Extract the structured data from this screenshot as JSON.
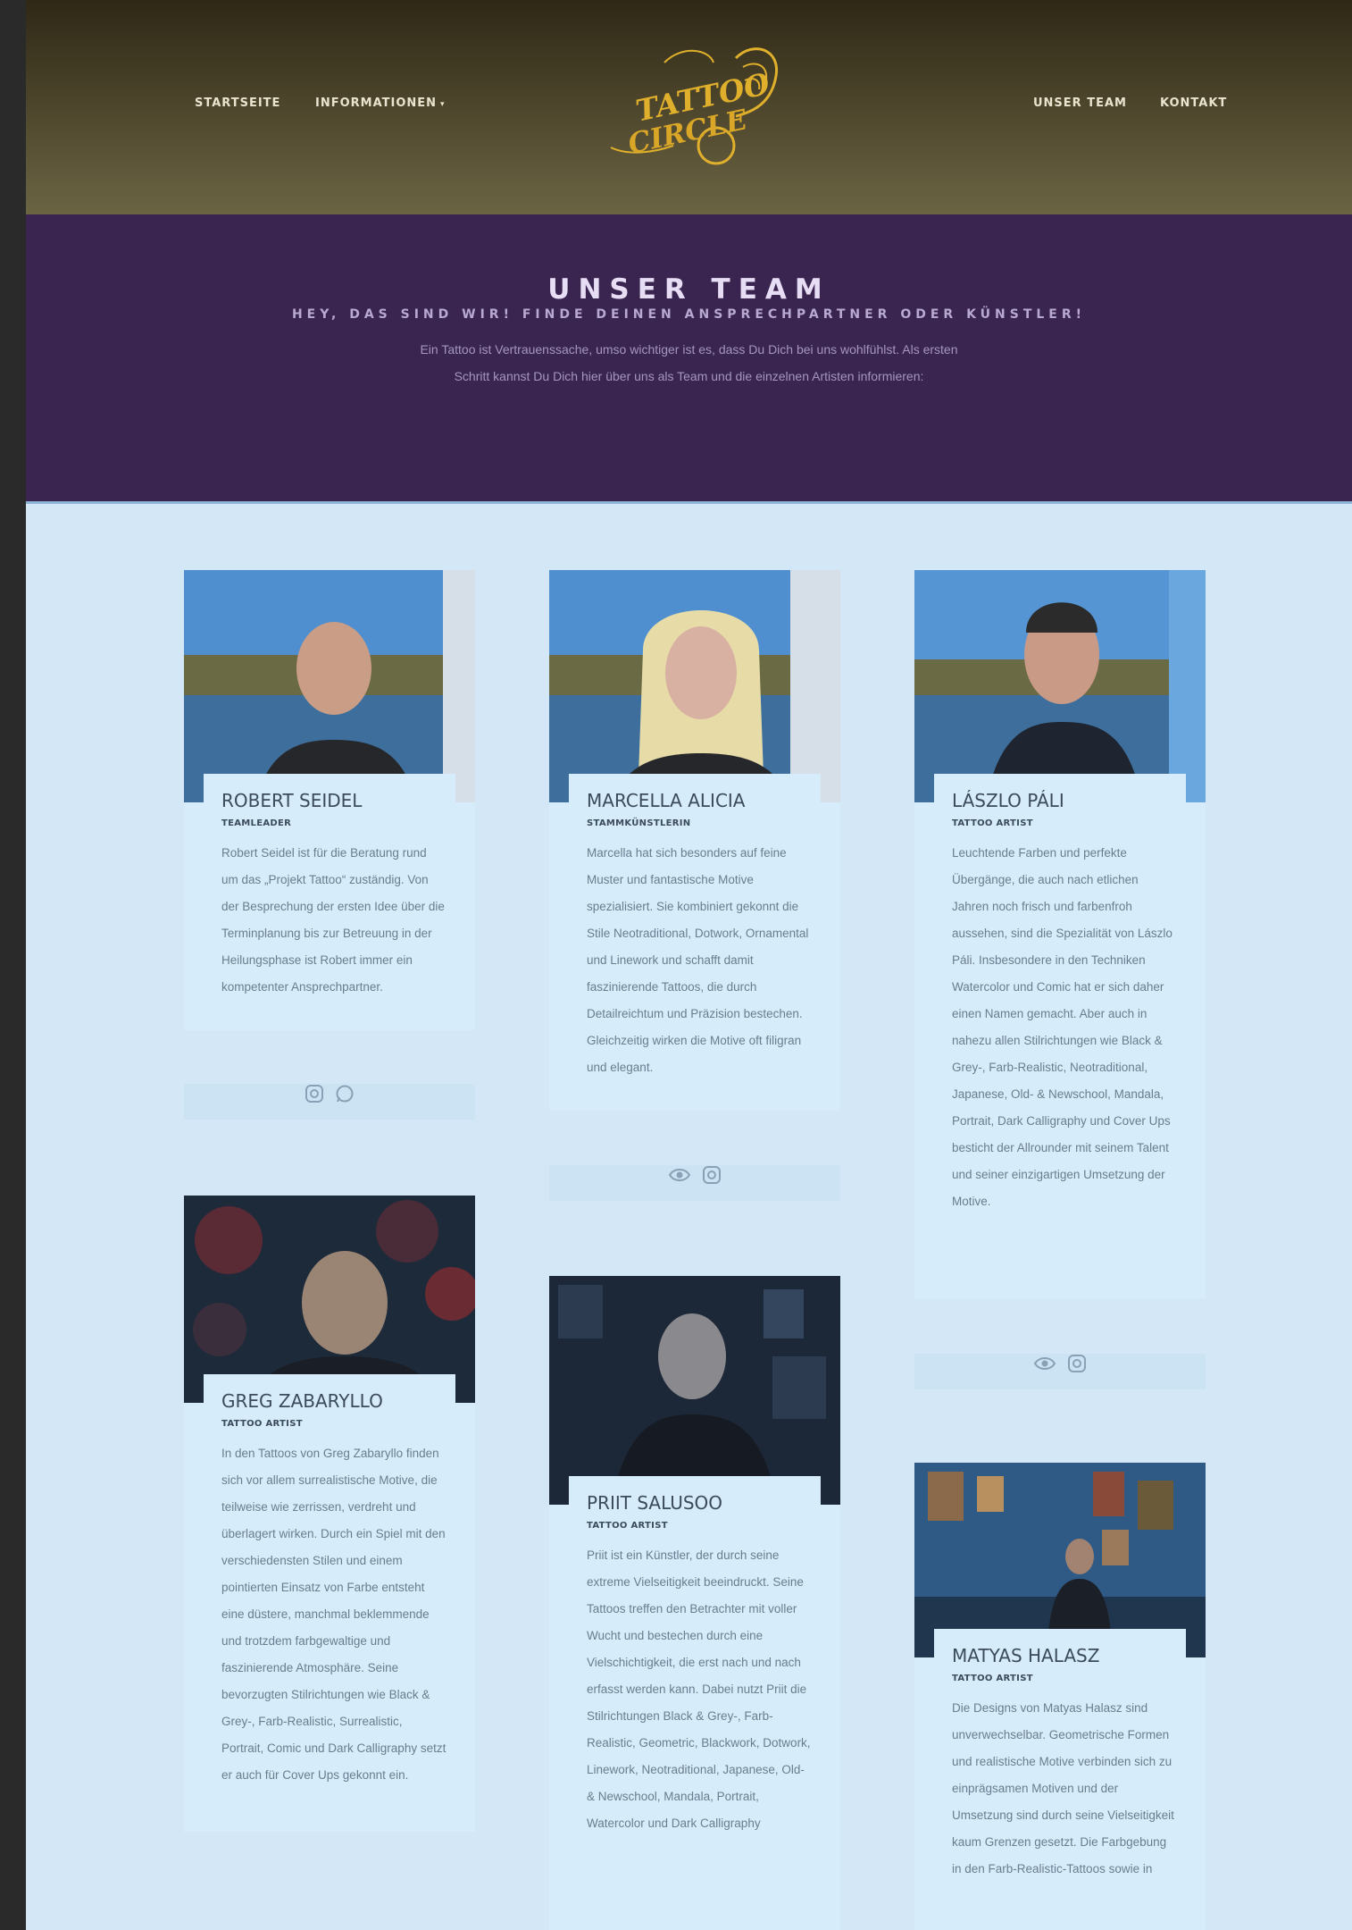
{
  "nav": {
    "startseite": "STARTSEITE",
    "informationen": "INFORMATIONEN",
    "unser_team": "UNSER TEAM",
    "kontakt": "KONTAKT",
    "dropdown_icon": "chevron-down-icon"
  },
  "logo": {
    "alt": "Tattoo Circle logo",
    "colors": {
      "gold": "#e0b02c",
      "dark_gold": "#9a7414"
    }
  },
  "hero": {
    "title": "UNSER TEAM",
    "subtitle": "HEY, DAS SIND WIR! FINDE DEINEN ANSPRECHPARTNER ODER KÜNSTLER!",
    "text": "Ein Tattoo ist Vertrauenssache, umso wichtiger ist es, dass Du Dich bei uns wohlfühlst. Als ersten Schritt kannst Du Dich hier über uns als Team und die einzelnen Artisten informieren:"
  },
  "team": [
    {
      "name": "ROBERT SEIDEL",
      "role": "TEAMLEADER",
      "description": "Robert Seidel ist für die Beratung rund um das „Projekt Tattoo“ zuständig. Von der Besprechung der ersten Idee über die Terminplanung bis zur Betreuung in der Heilungsphase ist Robert immer ein kompetenter Ansprechpartner.",
      "icons": [
        "instagram-icon",
        "whatsapp-icon"
      ]
    },
    {
      "name": "MARCELLA ALICIA",
      "role": "STAMMKÜNSTLERIN",
      "description": "Marcella hat sich besonders auf feine Muster und fantastische Motive spezialisiert. Sie kombiniert gekonnt die Stile Neotraditional, Dotwork, Ornamental und Linework und schafft damit faszinierende Tattoos, die durch Detailreichtum und Präzision bestechen. Gleichzeitig wirken die Motive oft filigran und elegant.",
      "icons": [
        "eye-icon",
        "instagram-icon"
      ]
    },
    {
      "name": "LÁSZLO PÁLI",
      "role": "TATTOO ARTIST",
      "description": "Leuchtende Farben und perfekte Übergänge, die auch nach etlichen Jahren noch frisch und farbenfroh aussehen, sind die Spezialität von Lászlo Páli. Insbesondere in den Techniken Watercolor und Comic hat er sich daher einen Namen gemacht. Aber auch in nahezu allen Stilrichtungen wie Black & Grey-, Farb-Realistic, Neotraditional, Japanese, Old- & Newschool, Mandala, Portrait, Dark Calligraphy und Cover Ups besticht der Allrounder mit seinem Talent und seiner einzigartigen Umsetzung der Motive.",
      "icons": [
        "eye-icon",
        "instagram-icon"
      ]
    },
    {
      "name": "GREG ZABARYLLO",
      "role": "TATTOO ARTIST",
      "description": "In den Tattoos von Greg Zabaryllo finden sich vor allem surrealistische Motive, die teilweise wie zerrissen, verdreht und überlagert wirken. Durch ein Spiel mit den verschiedensten Stilen und einem pointierten Einsatz von Farbe entsteht eine düstere, manchmal beklemmende und trotzdem farbgewaltige und faszinierende Atmosphäre. Seine bevorzugten Stilrichtungen wie Black & Grey-, Farb-Realistic, Surrealistic, Portrait, Comic und Dark Calligraphy setzt er auch für Cover Ups gekonnt ein.",
      "icons": []
    },
    {
      "name": "PRIIT SALUSOO",
      "role": "TATTOO ARTIST",
      "description": "Priit ist ein Künstler, der durch seine extreme Vielseitigkeit beeindruckt. Seine Tattoos treffen den Betrachter mit voller Wucht und bestechen durch eine Vielschichtigkeit, die erst nach und nach erfasst werden kann. Dabei nutzt Priit die Stilrichtungen Black & Grey-, Farb-Realistic, Geometric, Blackwork, Dotwork, Linework, Neotraditional, Japanese, Old- & Newschool, Mandala, Portrait, Watercolor und Dark Calligraphy",
      "icons": []
    },
    {
      "name": "MATYAS HALASZ",
      "role": "TATTOO ARTIST",
      "description": "Die Designs von Matyas Halasz sind unverwechselbar. Geometrische Formen und realistische Motive verbinden sich zu einprägsamen Motiven und der Umsetzung sind durch seine Vielseitigkeit kaum Grenzen gesetzt. Die Farbgebung in den Farb-Realistic-Tattoos sowie in",
      "icons": []
    }
  ]
}
